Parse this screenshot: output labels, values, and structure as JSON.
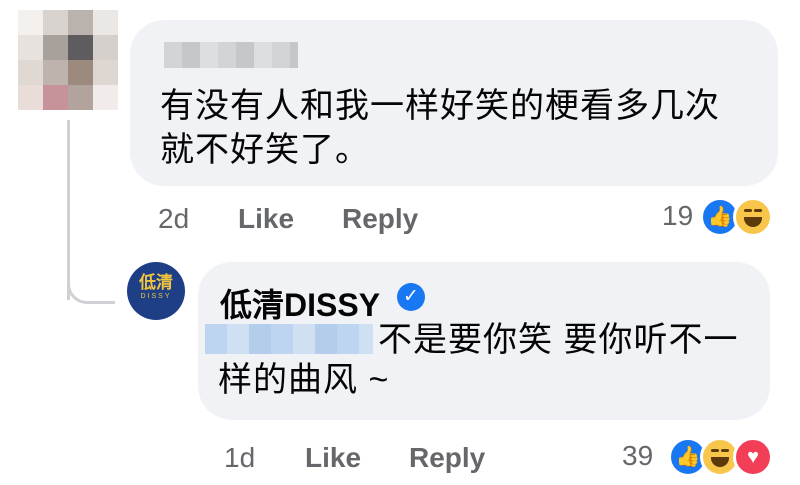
{
  "comment": {
    "text": "有没有人和我一样好笑的梗看多几次就不好笑了。",
    "time": "2d",
    "like_label": "Like",
    "reply_label": "Reply",
    "reaction_count": "19",
    "reactions": [
      "like-icon",
      "haha-icon"
    ]
  },
  "reply": {
    "author": "低清DISSY",
    "avatar_text": "低清",
    "avatar_subtext": "DISSY",
    "text_line1": "不是要你笑 要你听不一",
    "text_line2": "样的曲风 ~",
    "time": "1d",
    "like_label": "Like",
    "reply_label": "Reply",
    "reaction_count": "39",
    "reactions": [
      "like-icon",
      "haha-icon",
      "love-icon"
    ]
  },
  "colors": {
    "bubble": "#f0f2f5",
    "meta_text": "#65676b",
    "like_blue": "#1877f2",
    "haha_yellow": "#f7c64a",
    "love_red": "#f33e58",
    "thread_line": "#ced0d4"
  }
}
